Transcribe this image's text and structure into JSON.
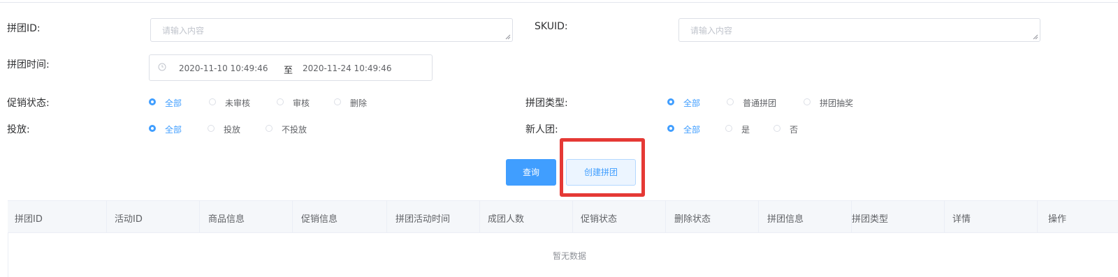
{
  "filters": {
    "group_id": {
      "label": "拼团ID:",
      "placeholder": "请输入内容"
    },
    "skuid": {
      "label": "SKUID:",
      "placeholder": "请输入内容"
    },
    "group_time": {
      "label": "拼团时间:",
      "start": "2020-11-10 10:49:46",
      "separator": "至",
      "end": "2020-11-24 10:49:46"
    },
    "promo_status": {
      "label": "促销状态:",
      "options": [
        "全部",
        "未审核",
        "审核",
        "删除"
      ],
      "selected": "全部"
    },
    "group_type": {
      "label": "拼团类型:",
      "options": [
        "全部",
        "普通拼团",
        "拼团抽奖"
      ],
      "selected": "全部"
    },
    "delivery": {
      "label": "投放:",
      "options": [
        "全部",
        "投放",
        "不投放"
      ],
      "selected": "全部"
    },
    "new_user_group": {
      "label": "新人团:",
      "options": [
        "全部",
        "是",
        "否"
      ],
      "selected": "全部"
    }
  },
  "actions": {
    "query": "查询",
    "create_group": "创建拼团"
  },
  "table": {
    "columns": [
      "拼团ID",
      "活动ID",
      "商品信息",
      "促销信息",
      "拼团活动时间",
      "成团人数",
      "促销状态",
      "删除状态",
      "拼团信息",
      "拼团类型",
      "详情",
      "操作"
    ],
    "rows": [],
    "empty_text": "暂无数据"
  },
  "colors": {
    "primary": "#409eff",
    "highlight_border": "#e53935"
  }
}
